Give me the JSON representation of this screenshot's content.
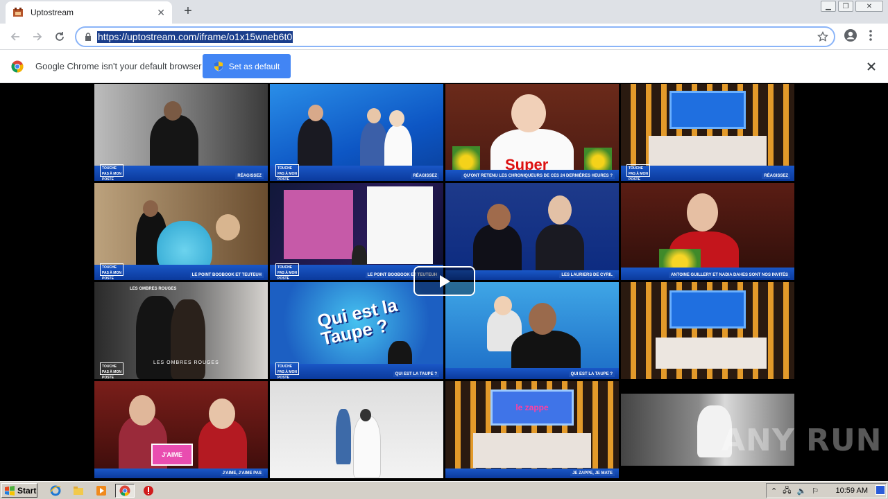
{
  "browser": {
    "tab_title": "Uptostream",
    "url": "https://uptostream.com/iframe/o1x15wneb6t0"
  },
  "infobar": {
    "message": "Google Chrome isn't your default browser",
    "button_label": "Set as default"
  },
  "video": {
    "thumbnails": [
      {
        "caption": "RÉAGISSEZ",
        "scene": "studio-man-back"
      },
      {
        "caption": "RÉAGISSEZ",
        "scene": "studio-hosts-blue"
      },
      {
        "caption": "QU'ONT RETENU LES CHRONIQUEURS DE CES 24 DERNIÈRES HEURES ?",
        "scene": "woman-super-shirt"
      },
      {
        "caption": "RÉAGISSEZ",
        "scene": "studio-wide"
      },
      {
        "caption": "LE POINT BOOBOOK ET TEUTEUH",
        "scene": "host-blue-puppet"
      },
      {
        "caption": "LE POINT BOOBOOK ET TEUTEUH",
        "scene": "studio-screen-tweet"
      },
      {
        "caption": "LES LAURIERS DE CYRIL",
        "scene": "two-men-laughing"
      },
      {
        "caption": "ANTOINE GUILLERY ET NADIA DAHES SONT NOS INVITÉS",
        "scene": "woman-audience"
      },
      {
        "caption": "LES OMBRES ROUGES",
        "scene": "couple-dark"
      },
      {
        "caption": "QUI EST LA TAUPE ?",
        "scene": "qui-est-la-taupe"
      },
      {
        "caption": "QUI EST LA TAUPE ?",
        "scene": "host-woman-blue"
      },
      {
        "caption": "",
        "scene": "studio-wide-2"
      },
      {
        "caption": "J'AIME, J'AIME PAS",
        "scene": "audience-jaime"
      },
      {
        "caption": "",
        "scene": "wedding-white"
      },
      {
        "caption": "JE ZAPPE, JE MATE",
        "scene": "le-zappe"
      },
      {
        "caption": "",
        "scene": "bw-street"
      }
    ],
    "big_labels": {
      "taupe": "Qui est la Taupe ?",
      "super": "Super",
      "ombres": "LES OMBRES ROUGES",
      "jaime": "J'AIME",
      "zappe": "le zappe"
    }
  },
  "watermark": "ANY RUN",
  "taskbar": {
    "start_label": "Start",
    "clock": "10:59 AM"
  },
  "colors": {
    "studio_blue": "#1f5fd0",
    "chrome_button": "#4285f4",
    "taskbar": "#d4d0c8"
  }
}
